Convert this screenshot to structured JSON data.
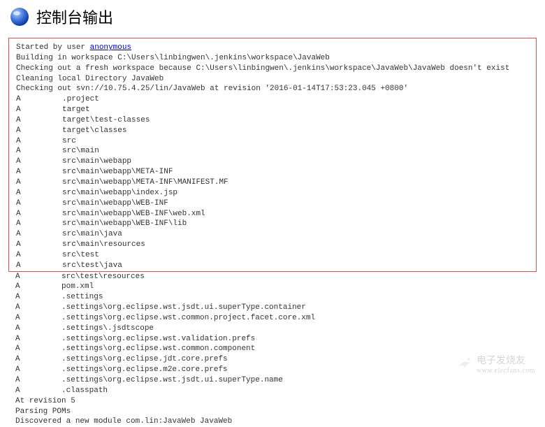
{
  "header": {
    "title": "控制台输出"
  },
  "console": {
    "started_by_prefix": "Started by user ",
    "started_by_user": "anonymous",
    "lines_pre_boxed": [
      "Building in workspace C:\\Users\\linbingwen\\.jenkins\\workspace\\JavaWeb",
      "Checking out a fresh workspace because C:\\Users\\linbingwen\\.jenkins\\workspace\\JavaWeb\\JavaWeb doesn't exist",
      "Cleaning local Directory JavaWeb",
      "Checking out svn://10.75.4.25/lin/JavaWeb at revision '2016-01-14T17:53:23.045 +0800'"
    ],
    "file_rows_boxed": [
      [
        "A",
        ".project"
      ],
      [
        "A",
        "target"
      ],
      [
        "A",
        "target\\test-classes"
      ],
      [
        "A",
        "target\\classes"
      ],
      [
        "A",
        "src"
      ],
      [
        "A",
        "src\\main"
      ],
      [
        "A",
        "src\\main\\webapp"
      ],
      [
        "A",
        "src\\main\\webapp\\META-INF"
      ],
      [
        "A",
        "src\\main\\webapp\\META-INF\\MANIFEST.MF"
      ],
      [
        "A",
        "src\\main\\webapp\\index.jsp"
      ],
      [
        "A",
        "src\\main\\webapp\\WEB-INF"
      ],
      [
        "A",
        "src\\main\\webapp\\WEB-INF\\web.xml"
      ],
      [
        "A",
        "src\\main\\webapp\\WEB-INF\\lib"
      ],
      [
        "A",
        "src\\main\\java"
      ],
      [
        "A",
        "src\\main\\resources"
      ],
      [
        "A",
        "src\\test"
      ],
      [
        "A",
        "src\\test\\java"
      ]
    ],
    "file_rows_after": [
      [
        "A",
        "src\\test\\resources"
      ],
      [
        "A",
        "pom.xml"
      ],
      [
        "A",
        ".settings"
      ],
      [
        "A",
        ".settings\\org.eclipse.wst.jsdt.ui.superType.container"
      ],
      [
        "A",
        ".settings\\org.eclipse.wst.common.project.facet.core.xml"
      ],
      [
        "A",
        ".settings\\.jsdtscope"
      ],
      [
        "A",
        ".settings\\org.eclipse.wst.validation.prefs"
      ],
      [
        "A",
        ".settings\\org.eclipse.wst.common.component"
      ],
      [
        "A",
        ".settings\\org.eclipse.jdt.core.prefs"
      ],
      [
        "A",
        ".settings\\org.eclipse.m2e.core.prefs"
      ],
      [
        "A",
        ".settings\\org.eclipse.wst.jsdt.ui.superType.name"
      ],
      [
        "A",
        ".classpath"
      ]
    ],
    "trailing_lines": [
      "At revision 5",
      "Parsing POMs",
      "Discovered a new module com.lin:JavaWeb JavaWeb"
    ]
  },
  "watermark": {
    "name": "电子发烧友",
    "url": "www.elecfans.com"
  }
}
